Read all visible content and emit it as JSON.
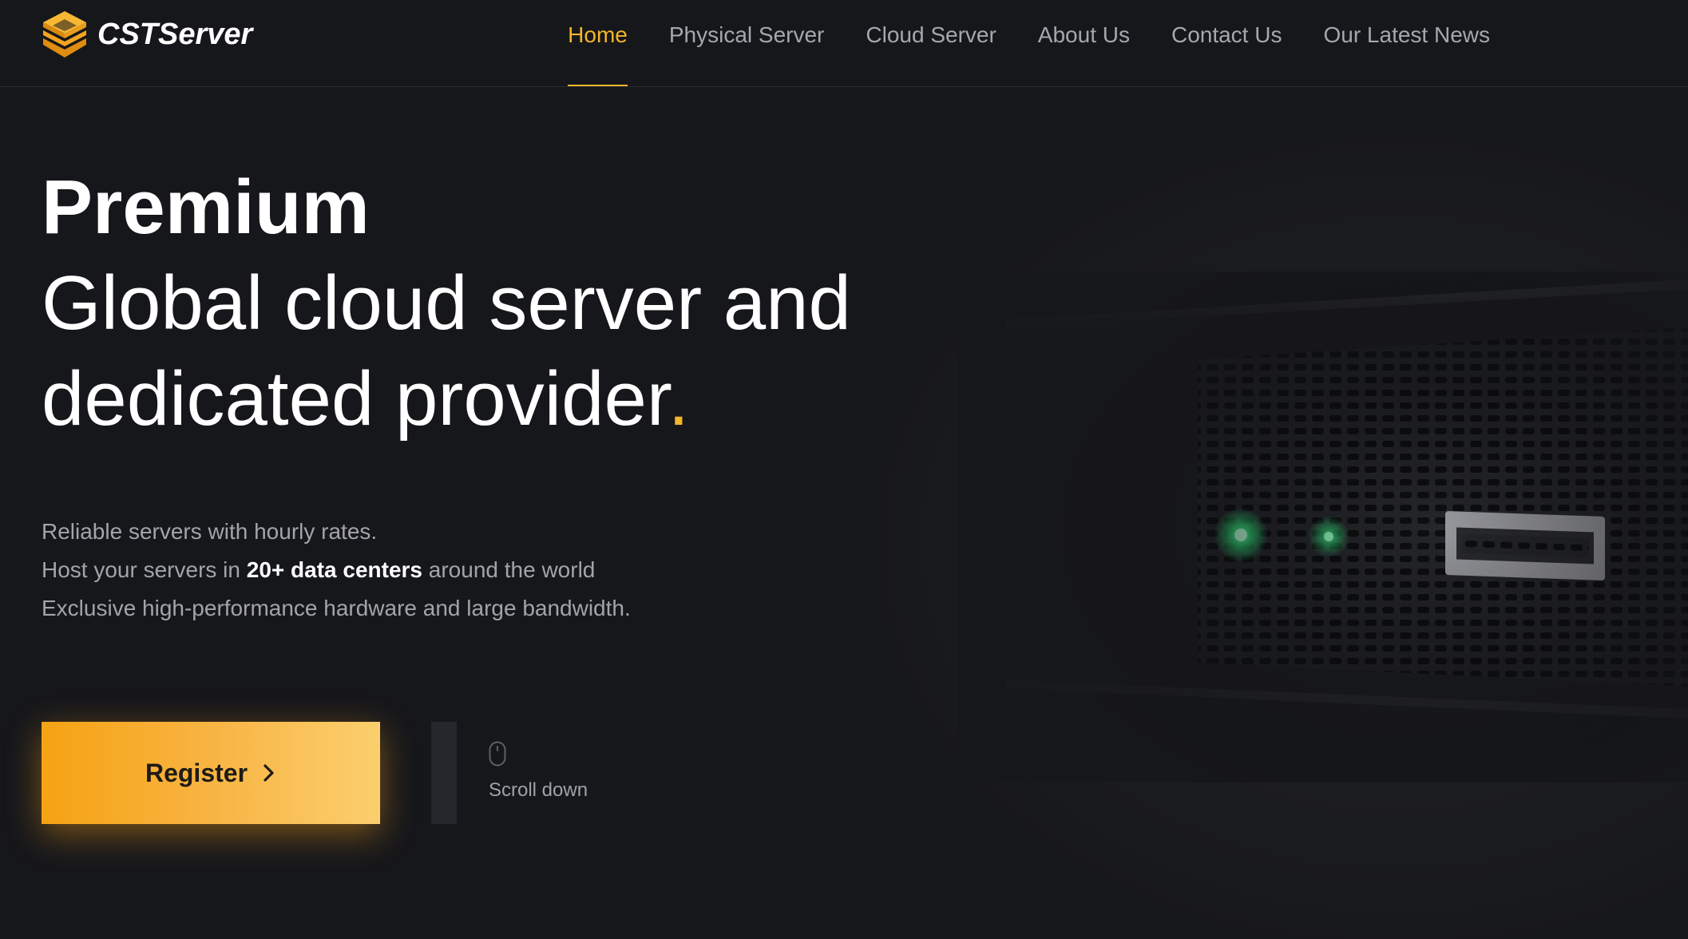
{
  "brand": {
    "name": "CSTServer",
    "logo_icon": "stacked-layers-logo-icon",
    "accent_color": "#f5b42a"
  },
  "nav": {
    "items": [
      {
        "label": "Home",
        "active": true
      },
      {
        "label": "Physical Server",
        "active": false
      },
      {
        "label": "Cloud Server",
        "active": false
      },
      {
        "label": "About Us",
        "active": false
      },
      {
        "label": "Contact Us",
        "active": false
      },
      {
        "label": "Our Latest News",
        "active": false
      }
    ]
  },
  "hero": {
    "title_strong": "Premium",
    "title_line1": "Global cloud server and",
    "title_line2": "dedicated provider",
    "title_dot": ".",
    "desc_line1": "Reliable servers with hourly rates.",
    "desc_line2_prefix": "Host your servers in ",
    "desc_line2_strong": "20+ data centers",
    "desc_line2_suffix": " around the world",
    "desc_line3": "Exclusive high-performance hardware and large bandwidth."
  },
  "cta": {
    "register_label": "Register",
    "register_icon": "chevron-right-icon",
    "scroll_label": "Scroll down",
    "scroll_icon": "mouse-icon",
    "button_color": "#f6a313"
  },
  "colors": {
    "background": "#16171b",
    "nav_text": "#a6a7ad",
    "status_led": "#3ddc84"
  }
}
